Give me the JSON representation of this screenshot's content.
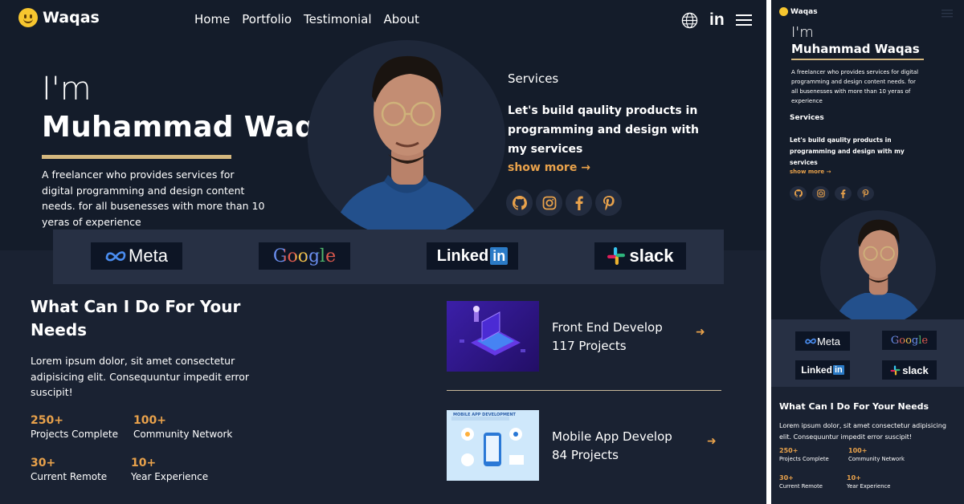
{
  "brand": {
    "name": "Waqas"
  },
  "nav": {
    "items": [
      "Home",
      "Portfolio",
      "Testimonial",
      "About"
    ]
  },
  "icons": {
    "globe": "globe-icon",
    "linkedin": "linkedin-icon",
    "menu": "hamburger-menu-icon"
  },
  "intro": {
    "greeting": "I'm",
    "name": "Muhammad Waqas",
    "description": "A freelancer who provides services for digital programming and design content needs. for all busenesses with more than 10 yeras of experience"
  },
  "services": {
    "label": "Services",
    "text": "Let's build qaulity products in programming and design with my services",
    "show_more": "show more →"
  },
  "socials": [
    "github-icon",
    "instagram-icon",
    "facebook-icon",
    "pinterest-icon"
  ],
  "brands": {
    "meta": "Meta",
    "google": "Google",
    "linkedin_word": "Linked",
    "linkedin_badge": "in",
    "slack": "slack"
  },
  "what": {
    "title": "What Can I Do For Your Needs",
    "description": "Lorem ipsum dolor, sit amet consectetur adipisicing elit. Consequuntur impedit error suscipit!",
    "stats": [
      {
        "value": "250+",
        "label": "Projects Complete"
      },
      {
        "value": "100+",
        "label": "Community Network"
      },
      {
        "value": "30+",
        "label": "Current Remote"
      },
      {
        "value": "10+",
        "label": "Year Experience"
      }
    ]
  },
  "service_cards": [
    {
      "title": "Front End Develop",
      "count": "117 Projects",
      "arrow": "➜"
    },
    {
      "title": "Mobile App Develop",
      "count": "84 Projects",
      "arrow": "➜",
      "image_caption": "MOBILE APP DEVELOPMENT"
    }
  ],
  "colors": {
    "accent": "#e9a24b",
    "underline": "#d4b77e",
    "background": "#1a2232",
    "hero": "#141c2a"
  }
}
